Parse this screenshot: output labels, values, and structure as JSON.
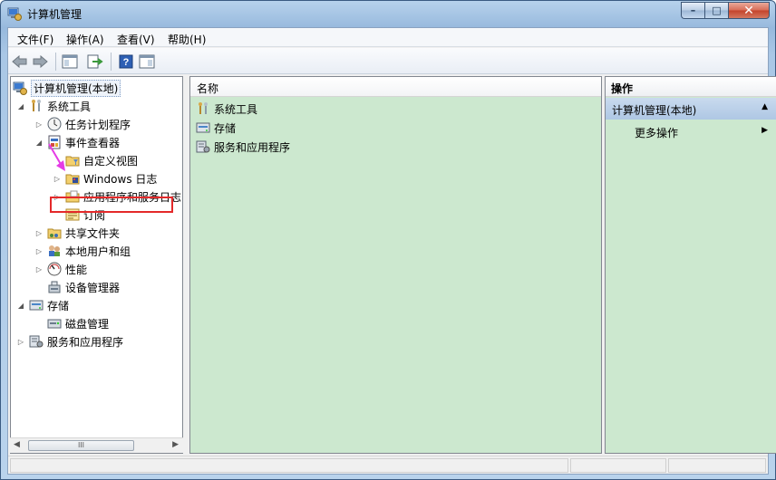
{
  "window": {
    "title": "计算机管理",
    "icon": "computer-management-icon",
    "buttons": {
      "minimize": "–",
      "maximize": "□",
      "close": "✕"
    }
  },
  "menu": [
    "文件(F)",
    "操作(A)",
    "查看(V)",
    "帮助(H)"
  ],
  "toolbar": [
    "back-icon",
    "forward-icon",
    "show-hide-console-tree-icon",
    "export-list-icon",
    "help-icon",
    "show-hide-action-pane-icon"
  ],
  "tree": {
    "root": "计算机管理(本地)",
    "system_tools": "系统工具",
    "task_scheduler": "任务计划程序",
    "event_viewer": "事件查看器",
    "custom_views": "自定义视图",
    "windows_logs": "Windows 日志",
    "app_service_logs": "应用程序和服务日志",
    "subscriptions": "订阅",
    "shared_folders": "共享文件夹",
    "local_users": "本地用户和组",
    "performance": "性能",
    "device_manager": "设备管理器",
    "storage": "存储",
    "disk_management": "磁盘管理",
    "services_apps": "服务和应用程序",
    "scroll_thumb": "III"
  },
  "center": {
    "column_header": "名称",
    "items": [
      "系统工具",
      "存储",
      "服务和应用程序"
    ]
  },
  "actions": {
    "header": "操作",
    "section": "计算机管理(本地)",
    "more": "更多操作"
  }
}
